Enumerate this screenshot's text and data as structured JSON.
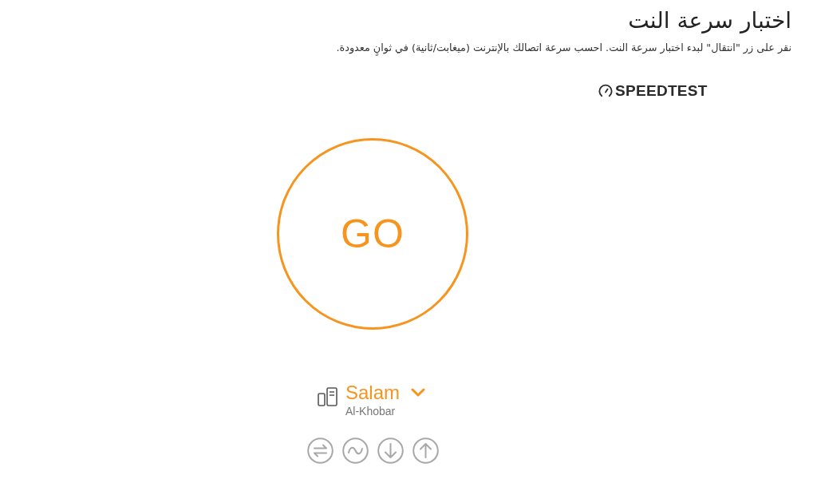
{
  "header": {
    "title": "اختبار سرعة النت",
    "description": "نقر على زر \"انتقال\" لبدء اختبار سرعة النت. احسب سرعة اتصالك بالإنترنت (ميغابت/ثانية) في ثوانٍ معدودة."
  },
  "speedtest": {
    "brand": "SPEEDTEST",
    "go_button": "GO",
    "server": {
      "name": "Salam",
      "location": "Al-Khobar"
    }
  }
}
